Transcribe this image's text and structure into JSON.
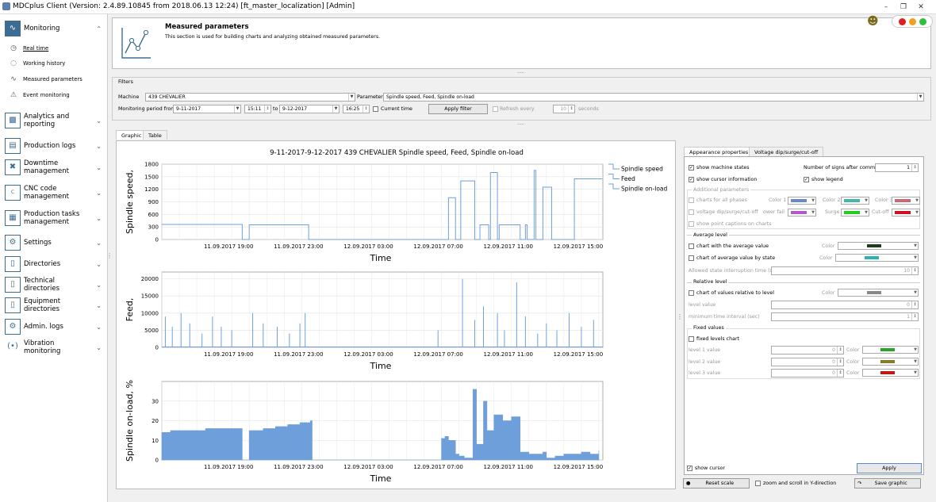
{
  "window": {
    "title": "MDCplus Client (Version: 2.4.89.10845 from 2018.06.13 12:24) [ft_master_localization]  [Admin]"
  },
  "sidebar": {
    "monitoring": {
      "label": "Monitoring",
      "items": [
        "Real time",
        "Working history",
        "Measured parameters",
        "Event monitoring"
      ]
    },
    "sections": [
      "Analytics and reporting",
      "Production logs",
      "Downtime management",
      "CNC code management",
      "Production tasks management",
      "Settings",
      "Directories",
      "Technical directories",
      "Equipment directories",
      "Admin. logs",
      "Vibration monitoring"
    ]
  },
  "header": {
    "title": "Measured parameters",
    "description": "This section is used for building charts and analyzing obtained measured parameters."
  },
  "filters": {
    "title": "Filters",
    "machine_label": "Machine",
    "machine_value": "439 CHEVALIER",
    "parameter_label": "Parameter",
    "parameter_value": "Spindle speed, Feed, Spindle on-load",
    "period_label": "Monitoring period from",
    "from_date": "9-11-2017",
    "from_time": "15:11",
    "to_label": "to",
    "to_date": "9-12-2017",
    "to_time": "16:25",
    "current_time_label": "Current time",
    "apply_label": "Apply filter",
    "refresh_label": "Refresh every",
    "refresh_value": "10",
    "seconds_label": "seconds"
  },
  "tabs": [
    "Graphic",
    "Table"
  ],
  "chart_data": {
    "type": "line",
    "title": "9-11-2017-9-12-2017 439 CHEVALIER Spindle speed, Feed, Spindle on-load",
    "legend": [
      "Spindle speed",
      "Feed",
      "Spindle on-load"
    ],
    "legend_position": "top-right",
    "xlabel": "Time",
    "x_ticks": [
      "11.09.2017 19:00",
      "11.09.2017 23:00",
      "12.09.2017 03:00",
      "12.09.2017 07:00",
      "12.09.2017 11:00",
      "12.09.2017 15:00"
    ],
    "x_range": [
      "11.09.2017 15:11",
      "12.09.2017 16:25"
    ],
    "grid": true,
    "color": "#6f9fdb",
    "panels": [
      {
        "ylabel": "Spindle speed,",
        "ylim": [
          0,
          1800
        ],
        "yticks": [
          0,
          300,
          600,
          900,
          1200,
          1500,
          1800
        ],
        "x_hours": [
          0,
          0.3,
          4.5,
          4.6,
          5.0,
          8.3,
          8.4,
          13.0,
          13.1,
          16.3,
          16.4,
          16.7,
          16.8,
          17.0,
          17.1,
          17.8,
          17.9,
          18.2,
          18.3,
          18.7,
          18.8,
          19.2,
          19.3,
          20.4,
          20.5,
          20.8,
          20.9,
          21.3,
          21.4,
          21.8,
          22.2,
          22.3,
          23.6,
          23.7,
          25.2
        ],
        "values": [
          360,
          360,
          360,
          0,
          350,
          350,
          0,
          0,
          0,
          0,
          1000,
          1000,
          0,
          0,
          1400,
          1400,
          0,
          350,
          350,
          0,
          1600,
          0,
          350,
          350,
          0,
          350,
          0,
          1650,
          0,
          1250,
          1250,
          0,
          1450,
          1450,
          1450
        ]
      },
      {
        "ylabel": "Feed,",
        "ylim": [
          0,
          22000
        ],
        "yticks": [
          0,
          5000,
          10000,
          15000,
          20000
        ],
        "x_hours": [
          0.2,
          0.6,
          1.1,
          1.6,
          2.3,
          2.9,
          3.4,
          4.0,
          5.2,
          5.8,
          6.6,
          7.3,
          7.9,
          8.2,
          15.8,
          17.2,
          17.9,
          18.4,
          19.2,
          19.6,
          20.3,
          20.8,
          21.5,
          22.0,
          22.6,
          23.3,
          24.0,
          24.7
        ],
        "values": [
          9000,
          6000,
          10000,
          7000,
          4000,
          9000,
          6000,
          5000,
          10000,
          7000,
          6000,
          4000,
          7000,
          10000,
          5000,
          20000,
          8000,
          12000,
          10000,
          5000,
          19000,
          9000,
          4000,
          7000,
          5000,
          10000,
          6000,
          8000
        ]
      },
      {
        "ylabel": "Spindle on-load, %",
        "ylim": [
          0,
          40
        ],
        "yticks": [
          0,
          10,
          20,
          30
        ],
        "x_hours": [
          0,
          0.5,
          1.0,
          1.5,
          2.0,
          2.5,
          3.0,
          3.5,
          4.0,
          4.5,
          4.6,
          4.9,
          5.0,
          5.8,
          6.5,
          7.2,
          7.9,
          8.5,
          8.6,
          15.9,
          16.0,
          16.2,
          16.4,
          16.8,
          17.0,
          17.3,
          17.8,
          18.0,
          18.4,
          18.6,
          19.0,
          19.5,
          20.0,
          20.5,
          21.0,
          21.5,
          21.8,
          22.0,
          22.5,
          23.0,
          23.5,
          24.0,
          24.5,
          25.0
        ],
        "values": [
          14,
          15,
          15,
          15,
          15,
          16,
          16,
          16,
          16,
          16,
          0,
          0,
          15,
          16,
          17,
          18,
          19,
          20,
          0,
          0,
          11,
          12,
          10,
          3,
          2,
          1,
          36,
          8,
          30,
          15,
          23,
          20,
          22,
          4,
          3,
          3,
          4,
          1,
          2,
          3,
          3,
          4,
          3,
          5
        ]
      }
    ]
  },
  "right_panel": {
    "tabs": [
      "Appearance properties",
      "Voltage dip/surge/cut-off"
    ],
    "show_machine_states": "show machine states",
    "show_cursor_information": "show cursor information",
    "signs_label": "Number of signs after comma",
    "signs_value": "1",
    "show_legend": "show legend",
    "additional_params_title": "Additional parameters",
    "charts_all_phases": "charts for all phases",
    "voltage_dip": "voltage dip/surge/cut-off",
    "show_point_captions": "show point captions on charts",
    "color1": "Color 1",
    "color2": "Color 2",
    "color3": "Color 3",
    "power_fail": "ower fail",
    "surge": "Surge",
    "cutoff": "Cut-off",
    "average_title": "Average level",
    "chart_avg": "chart with the average value",
    "chart_avg_state": "chart of average value by state",
    "color_label": "Color",
    "interruption_label": "Allowed state interruption time (s)",
    "interruption_value": "10",
    "relative_title": "Relative level",
    "chart_relative": "chart of values relative to level",
    "level_value_label": "level value",
    "level_value": "0",
    "min_interval_label": "minimum time interval (sec)",
    "min_interval_value": "1",
    "fixed_title": "Fixed values",
    "fixed_chart": "fixed levels chart",
    "level1": "level 1 value",
    "level2": "level 2 value",
    "level3": "level 3 value",
    "level_val": "0",
    "show_cursor": "show cursor",
    "apply": "Apply",
    "reset_scale": "Reset scale",
    "zoom_scroll": "zoom and scroll in Y-direction",
    "save_graphic": "Save graphic"
  },
  "colors": {
    "series": "#6f9fdb",
    "avg1": "#1f3a1f",
    "avg2": "#2eb3b3",
    "rel": "#888888",
    "fix1": "#2aa52a",
    "fix2": "#8c7a2c",
    "fix3": "#c01818",
    "c1": "#6688cc",
    "c2": "#44b8a8",
    "c3": "#cc6677",
    "pf": "#b25ac8",
    "sg": "#22cc22",
    "co": "#cc1122"
  }
}
